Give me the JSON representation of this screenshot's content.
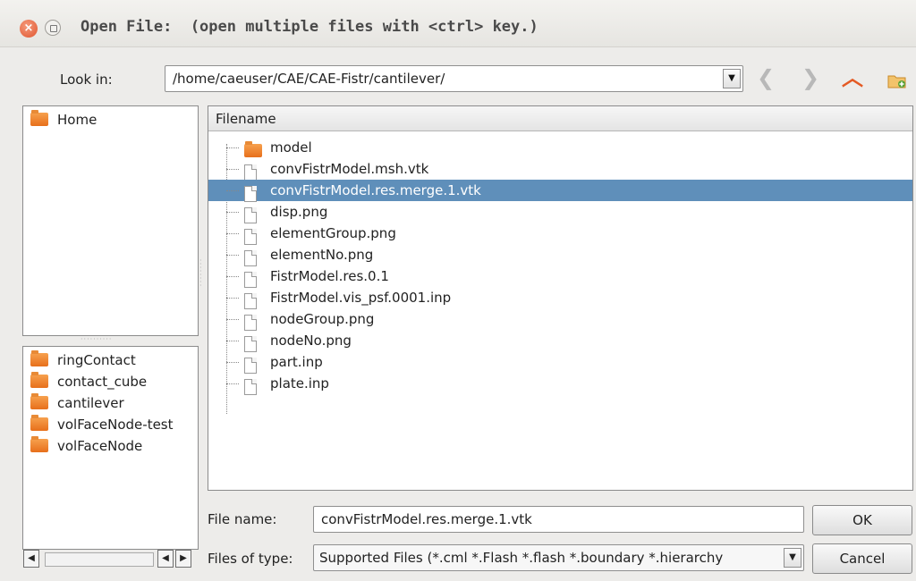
{
  "window": {
    "title": "Open File:  (open multiple files with <ctrl> key.)",
    "close_glyph": "×"
  },
  "look_in": {
    "label": "Look in:",
    "path": "/home/caeuser/CAE/CAE-Fistr/cantilever/"
  },
  "nav": {
    "back_glyph": "❮",
    "forward_glyph": "❯",
    "up_glyph": "︿"
  },
  "places": {
    "items": [
      {
        "label": "Home",
        "icon": "folder-icon"
      }
    ]
  },
  "recent": {
    "items": [
      {
        "label": "ringContact",
        "icon": "folder-icon"
      },
      {
        "label": "contact_cube",
        "icon": "folder-icon"
      },
      {
        "label": "cantilever",
        "icon": "folder-icon"
      },
      {
        "label": "volFaceNode-test",
        "icon": "folder-icon"
      },
      {
        "label": "volFaceNode",
        "icon": "folder-icon"
      }
    ]
  },
  "files": {
    "header": "Filename",
    "selected_index": 2,
    "rows": [
      {
        "name": "model",
        "icon": "folder-icon"
      },
      {
        "name": "convFistrModel.msh.vtk",
        "icon": "file-icon"
      },
      {
        "name": "convFistrModel.res.merge.1.vtk",
        "icon": "file-icon"
      },
      {
        "name": "disp.png",
        "icon": "file-icon"
      },
      {
        "name": "elementGroup.png",
        "icon": "file-icon"
      },
      {
        "name": "elementNo.png",
        "icon": "file-icon"
      },
      {
        "name": "FistrModel.res.0.1",
        "icon": "file-icon"
      },
      {
        "name": "FistrModel.vis_psf.0001.inp",
        "icon": "file-icon"
      },
      {
        "name": "nodeGroup.png",
        "icon": "file-icon"
      },
      {
        "name": "nodeNo.png",
        "icon": "file-icon"
      },
      {
        "name": "part.inp",
        "icon": "file-icon"
      },
      {
        "name": "plate.inp",
        "icon": "file-icon"
      }
    ]
  },
  "file_name": {
    "label": "File name:",
    "value": "convFistrModel.res.merge.1.vtk"
  },
  "file_type": {
    "label": "Files of type:",
    "value": "Supported Files (*.cml  *.Flash *.flash  *.boundary *.hierarchy"
  },
  "buttons": {
    "ok": "OK",
    "cancel": "Cancel"
  },
  "colors": {
    "selection": "#5f8fba",
    "folder": "#e76f1b",
    "up_arrow": "#e45a24"
  }
}
